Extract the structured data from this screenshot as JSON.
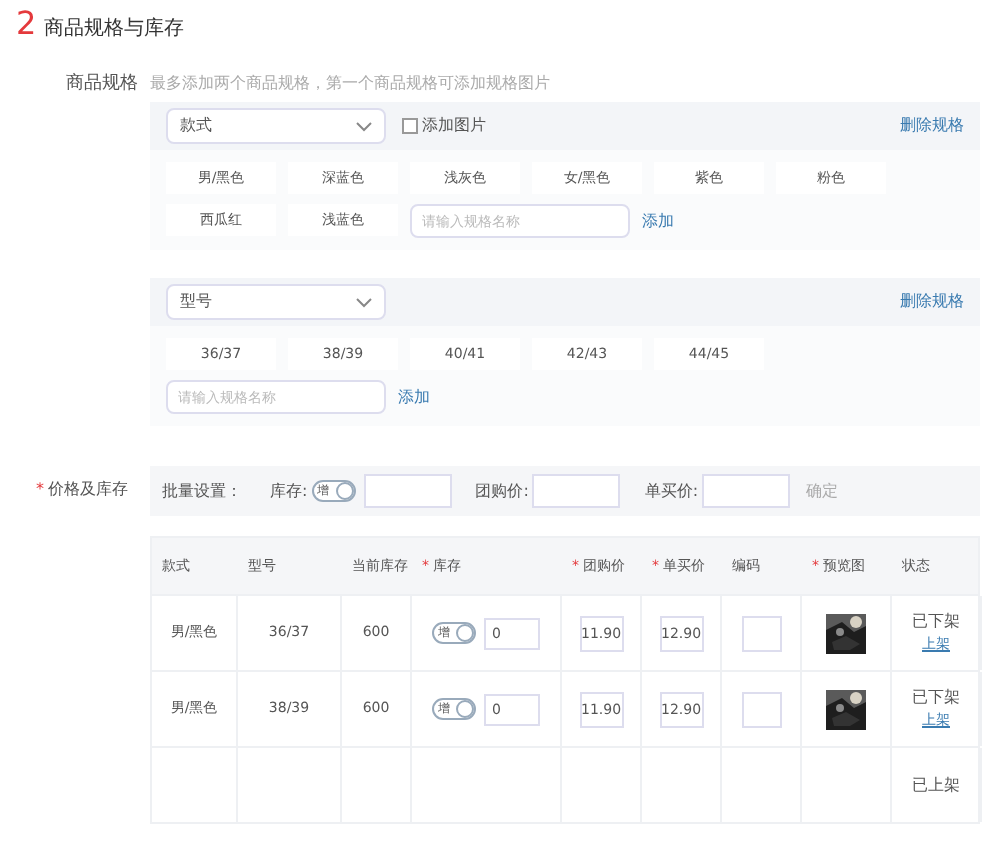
{
  "section": {
    "number": "2",
    "title": "商品规格与库存"
  },
  "specs": {
    "label": "商品规格",
    "hint": "最多添加两个商品规格，第一个商品规格可添加规格图片",
    "groups": [
      {
        "select": "款式",
        "add_image": {
          "label": "添加图片",
          "checked": false
        },
        "delete": "删除规格",
        "values": [
          "男/黑色",
          "深蓝色",
          "浅灰色",
          "女/黑色",
          "紫色",
          "粉色",
          "西瓜红",
          "浅蓝色"
        ],
        "placeholder": "请输入规格名称",
        "add": "添加"
      },
      {
        "select": "型号",
        "delete": "删除规格",
        "values": [
          "36/37",
          "38/39",
          "40/41",
          "42/43",
          "44/45"
        ],
        "placeholder": "请输入规格名称",
        "add": "添加"
      }
    ]
  },
  "price_stock": {
    "required_mark": "*",
    "label": "价格及库存",
    "batch": {
      "label": "批量设置：",
      "stock_label": "库存:",
      "toggle_text": "增",
      "group_label": "团购价:",
      "single_label": "单买价:",
      "confirm": "确定"
    },
    "table": {
      "columns": [
        {
          "label": "款式",
          "required": false
        },
        {
          "label": "型号",
          "required": false
        },
        {
          "label": "当前库存",
          "required": false
        },
        {
          "label": "库存",
          "required": true
        },
        {
          "label": "团购价",
          "required": true
        },
        {
          "label": "单买价",
          "required": true
        },
        {
          "label": "编码",
          "required": false
        },
        {
          "label": "预览图",
          "required": true
        },
        {
          "label": "状态",
          "required": false
        }
      ],
      "rows": [
        {
          "style": "男/黑色",
          "model": "36/37",
          "current": "600",
          "toggle_text": "增",
          "stock": "0",
          "group_price": "11.90",
          "single_price": "12.90",
          "status": "已下架",
          "action": "上架"
        },
        {
          "style": "男/黑色",
          "model": "38/39",
          "current": "600",
          "toggle_text": "增",
          "stock": "0",
          "group_price": "11.90",
          "single_price": "12.90",
          "status": "已下架",
          "action": "上架"
        },
        {
          "status": "已上架"
        }
      ]
    }
  }
}
